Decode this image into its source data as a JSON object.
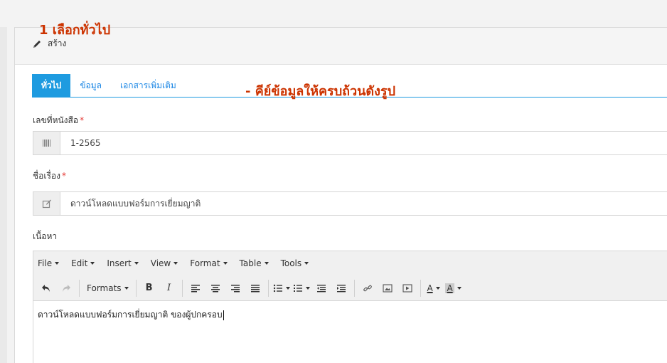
{
  "panel": {
    "title": "สร้าง"
  },
  "annotations": {
    "step1": "1 เลือกทั่วไป",
    "step2": "- คีย์ข้อมูลให้ครบถ้วนดังรูป"
  },
  "tabs": [
    {
      "label": "ทั่วไป",
      "active": true
    },
    {
      "label": "ข้อมูล",
      "active": false
    },
    {
      "label": "เอกสารเพิ่มเติม",
      "active": false
    }
  ],
  "fields": {
    "doc_number": {
      "label": "เลขที่หนังสือ",
      "required_mark": "*",
      "value": "1-2565",
      "icon": "barcode-icon"
    },
    "subject": {
      "label": "ชื่อเรื่อง",
      "required_mark": "*",
      "value": "ดาวน์โหลดแบบฟอร์มการเยี่ยมญาติ",
      "icon": "edit-icon"
    },
    "content": {
      "label": "เนื้อหา"
    }
  },
  "editor": {
    "menus": [
      "File",
      "Edit",
      "Insert",
      "View",
      "Format",
      "Table",
      "Tools"
    ],
    "formats_label": "Formats",
    "content": "ดาวน์โหลดแบบฟอร์มการเยี่ยมญาติ ของผู้ปกครอบ"
  },
  "colors": {
    "accent": "#1e9be0",
    "annotation": "#cc3300",
    "required": "#e53935"
  }
}
